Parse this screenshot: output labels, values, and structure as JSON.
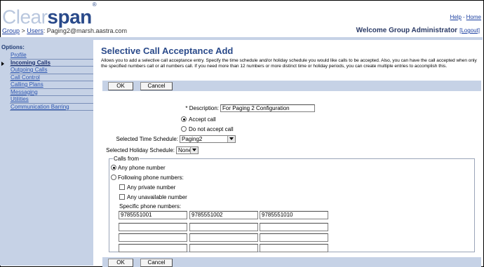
{
  "header": {
    "logo_clear": "Clear",
    "logo_span": "span",
    "logo_mark": "®",
    "help": "Help",
    "help_sep": "-",
    "home": "Home"
  },
  "crumb": {
    "group": "Group",
    "sep": " > ",
    "users": "Users",
    "path": ": Paging2@marsh.aastra.com"
  },
  "welcome": {
    "text": "Welcome Group Administrator",
    "logout": "[Logout]"
  },
  "sidebar": {
    "title": "Options:",
    "items": [
      {
        "label": "Profile"
      },
      {
        "label": "Incoming Calls"
      },
      {
        "label": "Outgoing Calls"
      },
      {
        "label": "Call Control"
      },
      {
        "label": "Calling Plans"
      },
      {
        "label": "Messaging"
      },
      {
        "label": "Utilities"
      },
      {
        "label": "Communication Barring"
      }
    ]
  },
  "main": {
    "title": "Selective Call Acceptance Add",
    "description": "Allows you to add a selective call acceptance entry. Specify the time schedule and/or holiday schedule you would like calls to be accepted. Also, you can have the call accepted when only the specified numbers call or all numbers call. If you need more than 12 numbers or more distinct time or holiday periods, you can create multiple entries to accomplish this."
  },
  "buttons": {
    "ok": "OK",
    "cancel": "Cancel"
  },
  "form": {
    "description_label": "* Description:",
    "description_value": "For Paging 2 Configuration",
    "accept_call": "Accept call",
    "do_not_accept_call": "Do not accept call",
    "time_schedule_label": "Selected Time Schedule:",
    "time_schedule_value": "Paging2",
    "holiday_schedule_label": "Selected Holiday Schedule:",
    "holiday_schedule_value": "None",
    "calls_from_legend": "Calls from",
    "any_phone_number": "Any phone number",
    "following_phone_numbers": "Following phone numbers:",
    "any_private_number": "Any private number",
    "any_unavailable_number": "Any unavailable number",
    "specific_numbers_label": "Specific phone numbers:",
    "numbers": [
      "9785551001",
      "9785551002",
      "9785551010",
      "",
      "",
      "",
      "",
      "",
      "",
      "",
      "",
      ""
    ]
  }
}
